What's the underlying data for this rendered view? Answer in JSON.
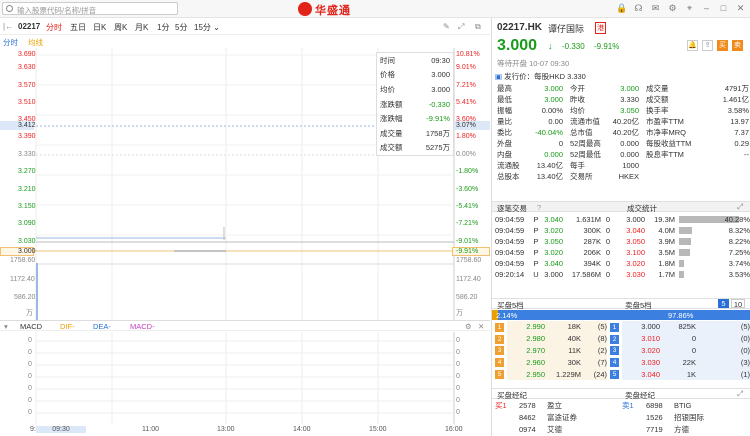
{
  "topbar": {
    "search_placeholder": "输入股票代码/名称/拼音",
    "logo": "华盛通"
  },
  "ktool": {
    "code": "02217",
    "tabs": [
      "分时",
      "五日",
      "日K",
      "周K",
      "月K",
      "1分",
      "5分",
      "15分 ⌄"
    ],
    "active": "分时"
  },
  "subleg": {
    "a": "分时",
    "b": "均线"
  },
  "yleft": [
    "3.690",
    "3.630",
    "3.570",
    "3.510",
    "3.450",
    "3.412",
    "3.390",
    "3.330",
    "3.270",
    "3.210",
    "3.150",
    "3.090",
    "3.030",
    "3.000",
    "1758.60",
    "1172.40",
    "586.20",
    "万"
  ],
  "yright": [
    "10.81%",
    "9.01%",
    "7.21%",
    "5.41%",
    "3.60%",
    "3.07%",
    "1.80%",
    "0.00%",
    "-1.80%",
    "-3.60%",
    "-5.41%",
    "-7.21%",
    "-9.01%",
    "-9.91%",
    "1758.60",
    "1172.40",
    "586.20",
    "万"
  ],
  "info": [
    {
      "k": "时间",
      "v": "09:30"
    },
    {
      "k": "价格",
      "v": "3.000"
    },
    {
      "k": "均价",
      "v": "3.000"
    },
    {
      "k": "涨跌额",
      "v": "-0.330"
    },
    {
      "k": "涨跌幅",
      "v": "-9.91%"
    },
    {
      "k": "成交量",
      "v": "1758万"
    },
    {
      "k": "成交额",
      "v": "5275万"
    }
  ],
  "macd": {
    "name": "MACD",
    "dif": "DIF-",
    "dea": "DEA-",
    "macd": "MACD-",
    "ticks": [
      "0",
      "0",
      "0",
      "0",
      "0",
      "0",
      "0",
      "0"
    ]
  },
  "taxis": [
    "9:",
    "09:30",
    "11:00",
    "13:00",
    "14:00",
    "15:00",
    "16:00"
  ],
  "stock": {
    "code": "02217.HK",
    "name": "谭仔国际",
    "tag": "港",
    "price": "3.000",
    "arrow": "↓",
    "chg": "-0.330",
    "pct": "-9.91%",
    "status": "等待开盘 10-07 09:30",
    "issue": "发行价：每股HKD 3.330"
  },
  "quote": [
    [
      "最高",
      "3.000",
      "今开",
      "3.000",
      "成交量",
      "4791万"
    ],
    [
      "最低",
      "3.000",
      "昨收",
      "3.330",
      "成交额",
      "1.461亿"
    ],
    [
      "振幅",
      "0.00%",
      "均价",
      "3.050",
      "换手率",
      "3.58%"
    ],
    [
      "量比",
      "0.00",
      "流通市值",
      "40.20亿",
      "市盈率TTM",
      "13.97"
    ],
    [
      "委比",
      "-40.04%",
      "总市值",
      "40.20亿",
      "市净率MRQ",
      "7.37"
    ],
    [
      "外盘",
      "0",
      "52周最高",
      "0.000",
      "每股收益TTM",
      "0.29"
    ],
    [
      "内盘",
      "0.000",
      "52周最低",
      "0.000",
      "股息率TTM",
      "--"
    ],
    [
      "流通股",
      "13.40亿",
      "每手",
      "1000",
      "",
      ""
    ],
    [
      "总股本",
      "13.40亿",
      "交易所",
      "HKEX",
      "",
      ""
    ]
  ],
  "ticks_hdr": {
    "a": "逐笔交易",
    "b": "成交统计"
  },
  "ticks": [
    [
      "09:04:59",
      "P",
      "3.040",
      "1.631M",
      "0",
      "3.000",
      "19.3M",
      "40.28%"
    ],
    [
      "09:04:59",
      "P",
      "3.020",
      "300K",
      "0",
      "3.040",
      "4.0M",
      "8.32%"
    ],
    [
      "09:04:59",
      "P",
      "3.050",
      "287K",
      "0",
      "3.050",
      "3.9M",
      "8.22%"
    ],
    [
      "09:04:59",
      "P",
      "3.020",
      "206K",
      "0",
      "3.100",
      "3.5M",
      "7.25%"
    ],
    [
      "09:04:59",
      "P",
      "3.040",
      "394K",
      "0",
      "3.020",
      "1.8M",
      "3.74%"
    ],
    [
      "09:20:14",
      "U",
      "3.000",
      "17.586M",
      "0",
      "3.030",
      "1.7M",
      "3.53%"
    ]
  ],
  "book_hdr": {
    "buy": "买盘5档",
    "sell": "卖盘5档",
    "n": "5",
    "m": "10",
    "bp": "2.14%",
    "sp": "97.86%"
  },
  "book": [
    [
      "1",
      "2.990",
      "18K",
      "(5)",
      "1",
      "3.000",
      "825K",
      "(5)"
    ],
    [
      "2",
      "2.980",
      "40K",
      "(8)",
      "2",
      "3.010",
      "0",
      "(0)"
    ],
    [
      "3",
      "2.970",
      "11K",
      "(2)",
      "3",
      "3.020",
      "0",
      "(0)"
    ],
    [
      "4",
      "2.960",
      "30K",
      "(7)",
      "4",
      "3.030",
      "22K",
      "(3)"
    ],
    [
      "5",
      "2.950",
      "1.229M",
      "(24)",
      "5",
      "3.040",
      "1K",
      "(1)"
    ]
  ],
  "brokers_hdr": {
    "buy": "买盘经纪",
    "sell": "卖盘经纪"
  },
  "brokers": [
    [
      "买1",
      "2578",
      "盈立",
      "卖1",
      "6898",
      "BTIG"
    ],
    [
      "",
      "8462",
      "富途证券",
      "",
      "1526",
      "招银国际"
    ],
    [
      "",
      "0974",
      "艾德",
      "",
      "7719",
      "方德"
    ]
  ]
}
